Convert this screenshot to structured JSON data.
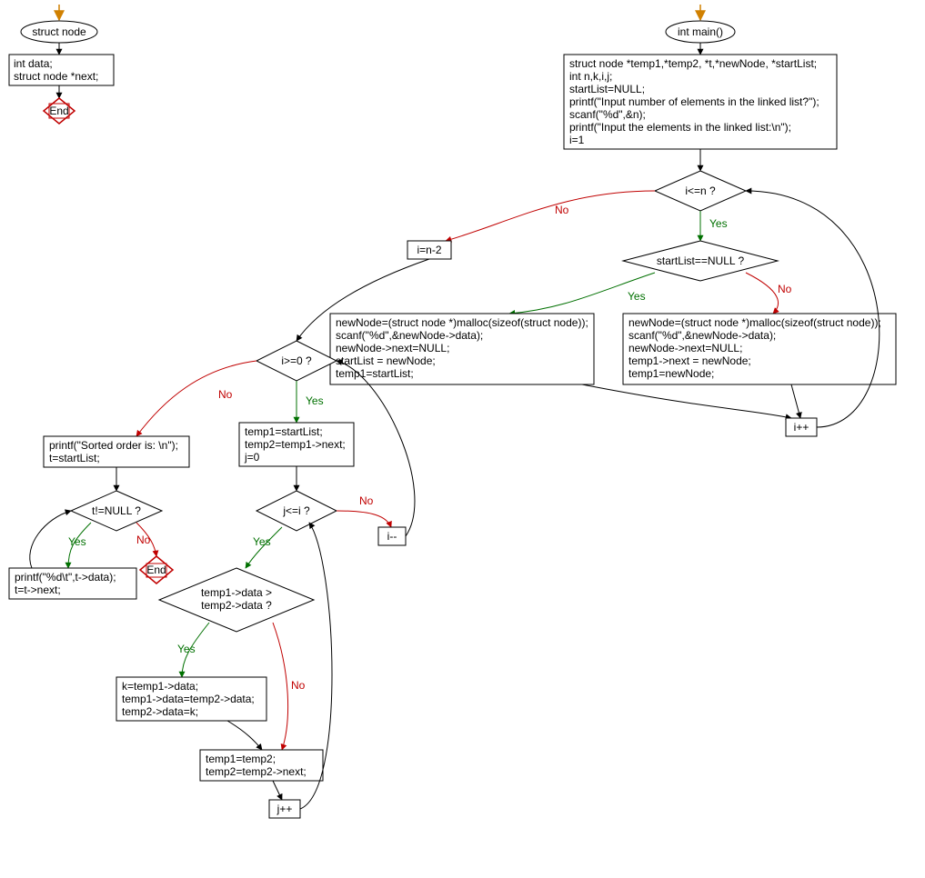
{
  "chart_data": {
    "type": "flowchart",
    "functions": [
      {
        "name": "struct node",
        "entry": "struct-node-start",
        "nodes": [
          {
            "id": "struct-node-start",
            "kind": "start",
            "label": "struct node"
          },
          {
            "id": "struct-node-body",
            "kind": "process",
            "lines": [
              "int data;",
              "struct node *next;"
            ]
          },
          {
            "id": "struct-node-end",
            "kind": "end",
            "label": "End"
          }
        ],
        "edges": [
          {
            "from": "struct-node-start",
            "to": "struct-node-body"
          },
          {
            "from": "struct-node-body",
            "to": "struct-node-end"
          }
        ]
      },
      {
        "name": "int main()",
        "entry": "main-start",
        "nodes": [
          {
            "id": "main-start",
            "kind": "start",
            "label": "int main()"
          },
          {
            "id": "main-init",
            "kind": "process",
            "lines": [
              "struct node *temp1,*temp2, *t,*newNode, *startList;",
              "int n,k,i,j;",
              "startList=NULL;",
              "printf(\"Input number of elements in the linked list?\");",
              "scanf(\"%d\",&n);",
              "printf(\"Input the elements in the linked list:\\n\");",
              "i=1"
            ]
          },
          {
            "id": "cond-i-le-n",
            "kind": "decision",
            "label": "i<=n ?"
          },
          {
            "id": "cond-start-null",
            "kind": "decision",
            "label": "startList==NULL ?"
          },
          {
            "id": "new-first",
            "kind": "process",
            "lines": [
              "newNode=(struct node *)malloc(sizeof(struct node));",
              "scanf(\"%d\",&newNode->data);",
              "newNode->next=NULL;",
              "startList = newNode;",
              "temp1=startList;"
            ]
          },
          {
            "id": "new-append",
            "kind": "process",
            "lines": [
              "newNode=(struct node *)malloc(sizeof(struct node));",
              "scanf(\"%d\",&newNode->data);",
              "newNode->next=NULL;",
              "temp1->next = newNode;",
              "temp1=newNode;"
            ]
          },
          {
            "id": "i-inc",
            "kind": "process",
            "lines": [
              "i++"
            ]
          },
          {
            "id": "i-set-n2",
            "kind": "process",
            "lines": [
              "i=n-2"
            ]
          },
          {
            "id": "cond-i-ge-0",
            "kind": "decision",
            "label": "i>=0 ?"
          },
          {
            "id": "sort-init",
            "kind": "process",
            "lines": [
              "temp1=startList;",
              "temp2=temp1->next;",
              "j=0"
            ]
          },
          {
            "id": "cond-j-le-i",
            "kind": "decision",
            "label": "j<=i ?"
          },
          {
            "id": "cond-compare",
            "kind": "decision",
            "label": "temp1->data > temp2->data ?"
          },
          {
            "id": "swap",
            "kind": "process",
            "lines": [
              "k=temp1->data;",
              "temp1->data=temp2->data;",
              "temp2->data=k;"
            ]
          },
          {
            "id": "advance",
            "kind": "process",
            "lines": [
              "temp1=temp2;",
              "temp2=temp2->next;"
            ]
          },
          {
            "id": "j-inc",
            "kind": "process",
            "lines": [
              "j++"
            ]
          },
          {
            "id": "i-dec",
            "kind": "process",
            "lines": [
              "i--"
            ]
          },
          {
            "id": "print-head",
            "kind": "process",
            "lines": [
              "printf(\"Sorted order is: \\n\");",
              "t=startList;"
            ]
          },
          {
            "id": "cond-t-null",
            "kind": "decision",
            "label": "t!=NULL ?"
          },
          {
            "id": "print-node",
            "kind": "process",
            "lines": [
              "printf(\"%d\\t\",t->data);",
              "t=t->next;"
            ]
          },
          {
            "id": "main-end",
            "kind": "end",
            "label": "End"
          }
        ],
        "edges": [
          {
            "from": "main-start",
            "to": "main-init"
          },
          {
            "from": "main-init",
            "to": "cond-i-le-n"
          },
          {
            "from": "cond-i-le-n",
            "to": "cond-start-null",
            "label": "Yes"
          },
          {
            "from": "cond-i-le-n",
            "to": "i-set-n2",
            "label": "No"
          },
          {
            "from": "cond-start-null",
            "to": "new-first",
            "label": "Yes"
          },
          {
            "from": "cond-start-null",
            "to": "new-append",
            "label": "No"
          },
          {
            "from": "new-first",
            "to": "i-inc"
          },
          {
            "from": "new-append",
            "to": "i-inc"
          },
          {
            "from": "i-inc",
            "to": "cond-i-le-n"
          },
          {
            "from": "i-set-n2",
            "to": "cond-i-ge-0"
          },
          {
            "from": "cond-i-ge-0",
            "to": "sort-init",
            "label": "Yes"
          },
          {
            "from": "cond-i-ge-0",
            "to": "print-head",
            "label": "No"
          },
          {
            "from": "sort-init",
            "to": "cond-j-le-i"
          },
          {
            "from": "cond-j-le-i",
            "to": "cond-compare",
            "label": "Yes"
          },
          {
            "from": "cond-j-le-i",
            "to": "i-dec",
            "label": "No"
          },
          {
            "from": "cond-compare",
            "to": "swap",
            "label": "Yes"
          },
          {
            "from": "cond-compare",
            "to": "advance",
            "label": "No"
          },
          {
            "from": "swap",
            "to": "advance"
          },
          {
            "from": "advance",
            "to": "j-inc"
          },
          {
            "from": "j-inc",
            "to": "cond-j-le-i"
          },
          {
            "from": "i-dec",
            "to": "cond-i-ge-0"
          },
          {
            "from": "print-head",
            "to": "cond-t-null"
          },
          {
            "from": "cond-t-null",
            "to": "print-node",
            "label": "Yes"
          },
          {
            "from": "cond-t-null",
            "to": "main-end",
            "label": "No"
          },
          {
            "from": "print-node",
            "to": "cond-t-null"
          }
        ]
      }
    ]
  },
  "labels": {
    "yes": "Yes",
    "no": "No",
    "end": "End"
  },
  "nodes": {
    "struct_start": "struct node",
    "struct_body_l1": "int data;",
    "struct_body_l2": "struct node *next;",
    "main_start": "int main()",
    "main_init_l1": "struct node *temp1,*temp2, *t,*newNode, *startList;",
    "main_init_l2": "int n,k,i,j;",
    "main_init_l3": "startList=NULL;",
    "main_init_l4": "printf(\"Input number of elements in the linked list?\");",
    "main_init_l5": "scanf(\"%d\",&n);",
    "main_init_l6": "printf(\"Input the elements in the linked list:\\n\");",
    "main_init_l7": "i=1",
    "cond_ilen": "i<=n ?",
    "cond_startnull": "startList==NULL ?",
    "new_first_l1": "newNode=(struct node *)malloc(sizeof(struct node));",
    "new_first_l2": "scanf(\"%d\",&newNode->data);",
    "new_first_l3": "newNode->next=NULL;",
    "new_first_l4": "startList = newNode;",
    "new_first_l5": "temp1=startList;",
    "new_append_l1": "newNode=(struct node *)malloc(sizeof(struct node));",
    "new_append_l2": "scanf(\"%d\",&newNode->data);",
    "new_append_l3": "newNode->next=NULL;",
    "new_append_l4": "temp1->next = newNode;",
    "new_append_l5": "temp1=newNode;",
    "i_inc": "i++",
    "i_set_n2": "i=n-2",
    "cond_ige0": "i>=0 ?",
    "sort_init_l1": "temp1=startList;",
    "sort_init_l2": "temp2=temp1->next;",
    "sort_init_l3": "j=0",
    "cond_jlei": "j<=i ?",
    "cond_cmp_l1": "temp1->data >",
    "cond_cmp_l2": "temp2->data ?",
    "swap_l1": "k=temp1->data;",
    "swap_l2": "temp1->data=temp2->data;",
    "swap_l3": "temp2->data=k;",
    "adv_l1": "temp1=temp2;",
    "adv_l2": "temp2=temp2->next;",
    "j_inc": "j++",
    "i_dec": "i--",
    "print_head_l1": "printf(\"Sorted order is: \\n\");",
    "print_head_l2": "t=startList;",
    "cond_tnull": "t!=NULL ?",
    "print_node_l1": "printf(\"%d\\t\",t->data);",
    "print_node_l2": "t=t->next;"
  }
}
